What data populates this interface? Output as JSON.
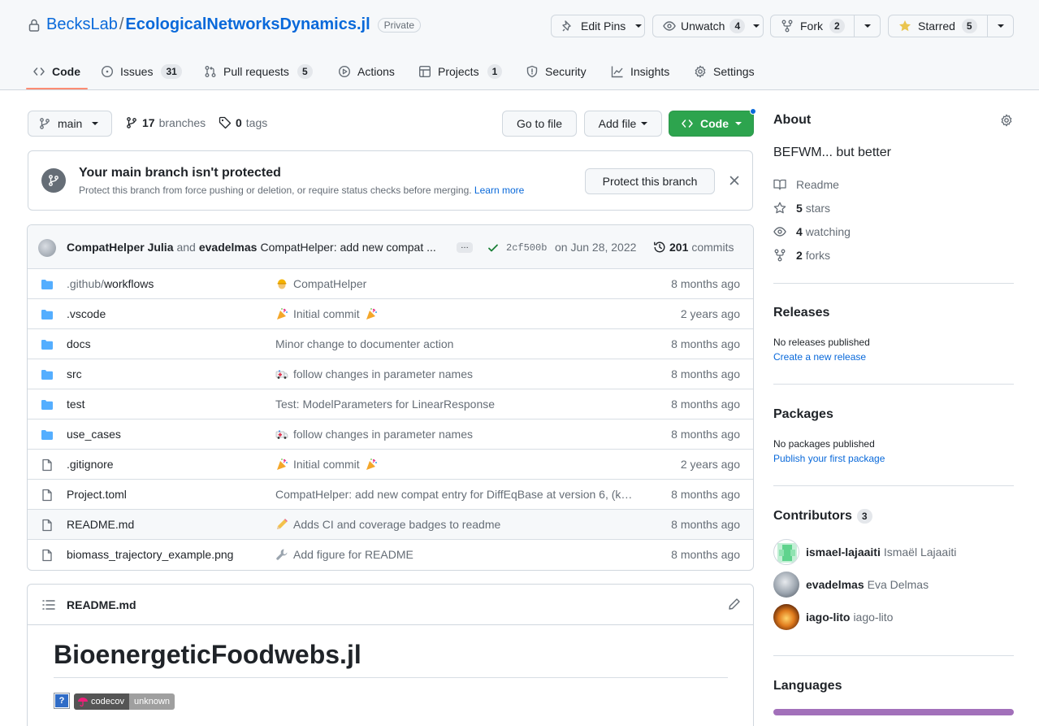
{
  "repo": {
    "owner": "BecksLab",
    "separator": "/",
    "name": "EcologicalNetworksDynamics.jl",
    "visibility": "Private"
  },
  "header_actions": {
    "edit_pins": "Edit Pins",
    "unwatch": "Unwatch",
    "watch_count": "4",
    "fork": "Fork",
    "fork_count": "2",
    "starred": "Starred",
    "star_count": "5"
  },
  "tabs": [
    {
      "label": "Code",
      "icon": "code-icon",
      "count": ""
    },
    {
      "label": "Issues",
      "icon": "issue-icon",
      "count": "31"
    },
    {
      "label": "Pull requests",
      "icon": "pull-request-icon",
      "count": "5"
    },
    {
      "label": "Actions",
      "icon": "play-icon",
      "count": ""
    },
    {
      "label": "Projects",
      "icon": "table-icon",
      "count": "1"
    },
    {
      "label": "Security",
      "icon": "shield-icon",
      "count": ""
    },
    {
      "label": "Insights",
      "icon": "graph-icon",
      "count": ""
    },
    {
      "label": "Settings",
      "icon": "gear-icon",
      "count": ""
    }
  ],
  "toolbar": {
    "branch": "main",
    "branches_count": "17",
    "branches_label": "branches",
    "tags_count": "0",
    "tags_label": "tags",
    "go_to_file": "Go to file",
    "add_file": "Add file",
    "code": "Code"
  },
  "protect_banner": {
    "title": "Your main branch isn't protected",
    "description": "Protect this branch from force pushing or deletion, or require status checks before merging.",
    "learn_more": "Learn more",
    "button": "Protect this branch"
  },
  "latest_commit": {
    "author1": "CompatHelper Julia",
    "and": "and",
    "author2": "evadelmas",
    "message": "CompatHelper: add new compat ...",
    "ellipsis": "…",
    "sha": "2cf500b",
    "date": "on Jun 28, 2022",
    "commits_count": "201",
    "commits_label": "commits"
  },
  "files": [
    {
      "type": "dir",
      "name_prefix": ".github/",
      "name": "workflows",
      "emoji": "construction-worker",
      "message": "CompatHelper",
      "date": "8 months ago"
    },
    {
      "type": "dir",
      "name_prefix": "",
      "name": ".vscode",
      "emoji": "tada",
      "message": "Initial commit",
      "emoji_after": "tada",
      "date": "2 years ago"
    },
    {
      "type": "dir",
      "name_prefix": "",
      "name": "docs",
      "emoji": "",
      "message": "Minor change to documenter action",
      "date": "8 months ago"
    },
    {
      "type": "dir",
      "name_prefix": "",
      "name": "src",
      "emoji": "ambulance",
      "message": "follow changes in parameter names",
      "date": "8 months ago"
    },
    {
      "type": "dir",
      "name_prefix": "",
      "name": "test",
      "emoji": "",
      "message": "Test: ModelParameters for LinearResponse",
      "date": "8 months ago"
    },
    {
      "type": "dir",
      "name_prefix": "",
      "name": "use_cases",
      "emoji": "ambulance",
      "message": "follow changes in parameter names",
      "date": "8 months ago"
    },
    {
      "type": "file",
      "name_prefix": "",
      "name": ".gitignore",
      "emoji": "tada",
      "message": "Initial commit",
      "emoji_after": "tada",
      "date": "2 years ago"
    },
    {
      "type": "file",
      "name_prefix": "",
      "name": "Project.toml",
      "emoji": "",
      "message": "CompatHelper: add new compat entry for DiffEqBase at version 6, (k…",
      "date": "8 months ago"
    },
    {
      "type": "file",
      "name_prefix": "",
      "name": "README.md",
      "emoji": "pencil",
      "message": "Adds CI and coverage badges to readme",
      "date": "8 months ago"
    },
    {
      "type": "file",
      "name_prefix": "",
      "name": "biomass_trajectory_example.png",
      "emoji": "wrench",
      "message": "Add figure for README",
      "date": "8 months ago"
    }
  ],
  "readme": {
    "filename": "README.md",
    "title": "BioenergeticFoodwebs.jl",
    "badge_broken": "?",
    "badge_left": "codecov",
    "badge_right": "unknown"
  },
  "about": {
    "heading": "About",
    "description": "BEFWM... but better",
    "readme": "Readme",
    "stars_count": "5",
    "stars_label": "stars",
    "watching_count": "4",
    "watching_label": "watching",
    "forks_count": "2",
    "forks_label": "forks"
  },
  "releases": {
    "heading": "Releases",
    "empty": "No releases published",
    "link": "Create a new release"
  },
  "packages": {
    "heading": "Packages",
    "empty": "No packages published",
    "link": "Publish your first package"
  },
  "contributors": {
    "heading": "Contributors",
    "count": "3",
    "people": [
      {
        "login": "ismael-lajaaiti",
        "name": "Ismaël Lajaaiti"
      },
      {
        "login": "evadelmas",
        "name": "Eva Delmas"
      },
      {
        "login": "iago-lito",
        "name": "iago-lito"
      }
    ]
  },
  "languages": {
    "heading": "Languages",
    "bar_color": "#a270ba",
    "julia_fraction": 1.0
  },
  "colors": {
    "accent": "#0969da",
    "primary_button": "#2da44e",
    "header_bg": "#f6f8fa",
    "tab_underline": "#fd8c73"
  }
}
